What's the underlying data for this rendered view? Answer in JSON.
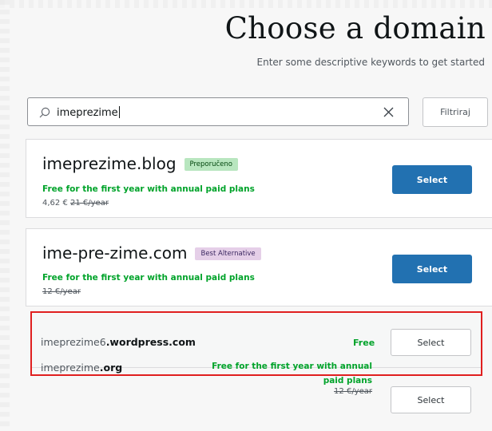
{
  "header": {
    "title": "Choose a domain",
    "subtitle": "Enter some descriptive keywords to get started"
  },
  "search": {
    "value": "imeprezime",
    "filter_label": "Filtriraj"
  },
  "cards": [
    {
      "domain": "imeprezime.blog",
      "tag": "Preporučeno",
      "free_text": "Free for the first year with annual paid plans",
      "price": "4,62 €",
      "original_price": "21 €/year",
      "button": "Select"
    },
    {
      "domain": "ime-pre-zime.com",
      "tag": "Best Alternative",
      "free_text": "Free for the first year with annual paid plans",
      "original_price": "12 €/year",
      "button": "Select"
    }
  ],
  "rows": [
    {
      "domain_prefix": "imeprezime6",
      "domain_suffix": ".wordpress.com",
      "price_text": "Free",
      "button": "Select"
    },
    {
      "domain_prefix": "imeprezime",
      "domain_suffix": ".org",
      "free_text_line1": "Free for the first year with annual",
      "free_text_line2": "paid plans",
      "original_price": "12 €/year",
      "button": "Select"
    }
  ],
  "colors": {
    "primary_button": "#2271b1",
    "free_text": "#00a32a",
    "highlight_border": "#e01f1f"
  }
}
